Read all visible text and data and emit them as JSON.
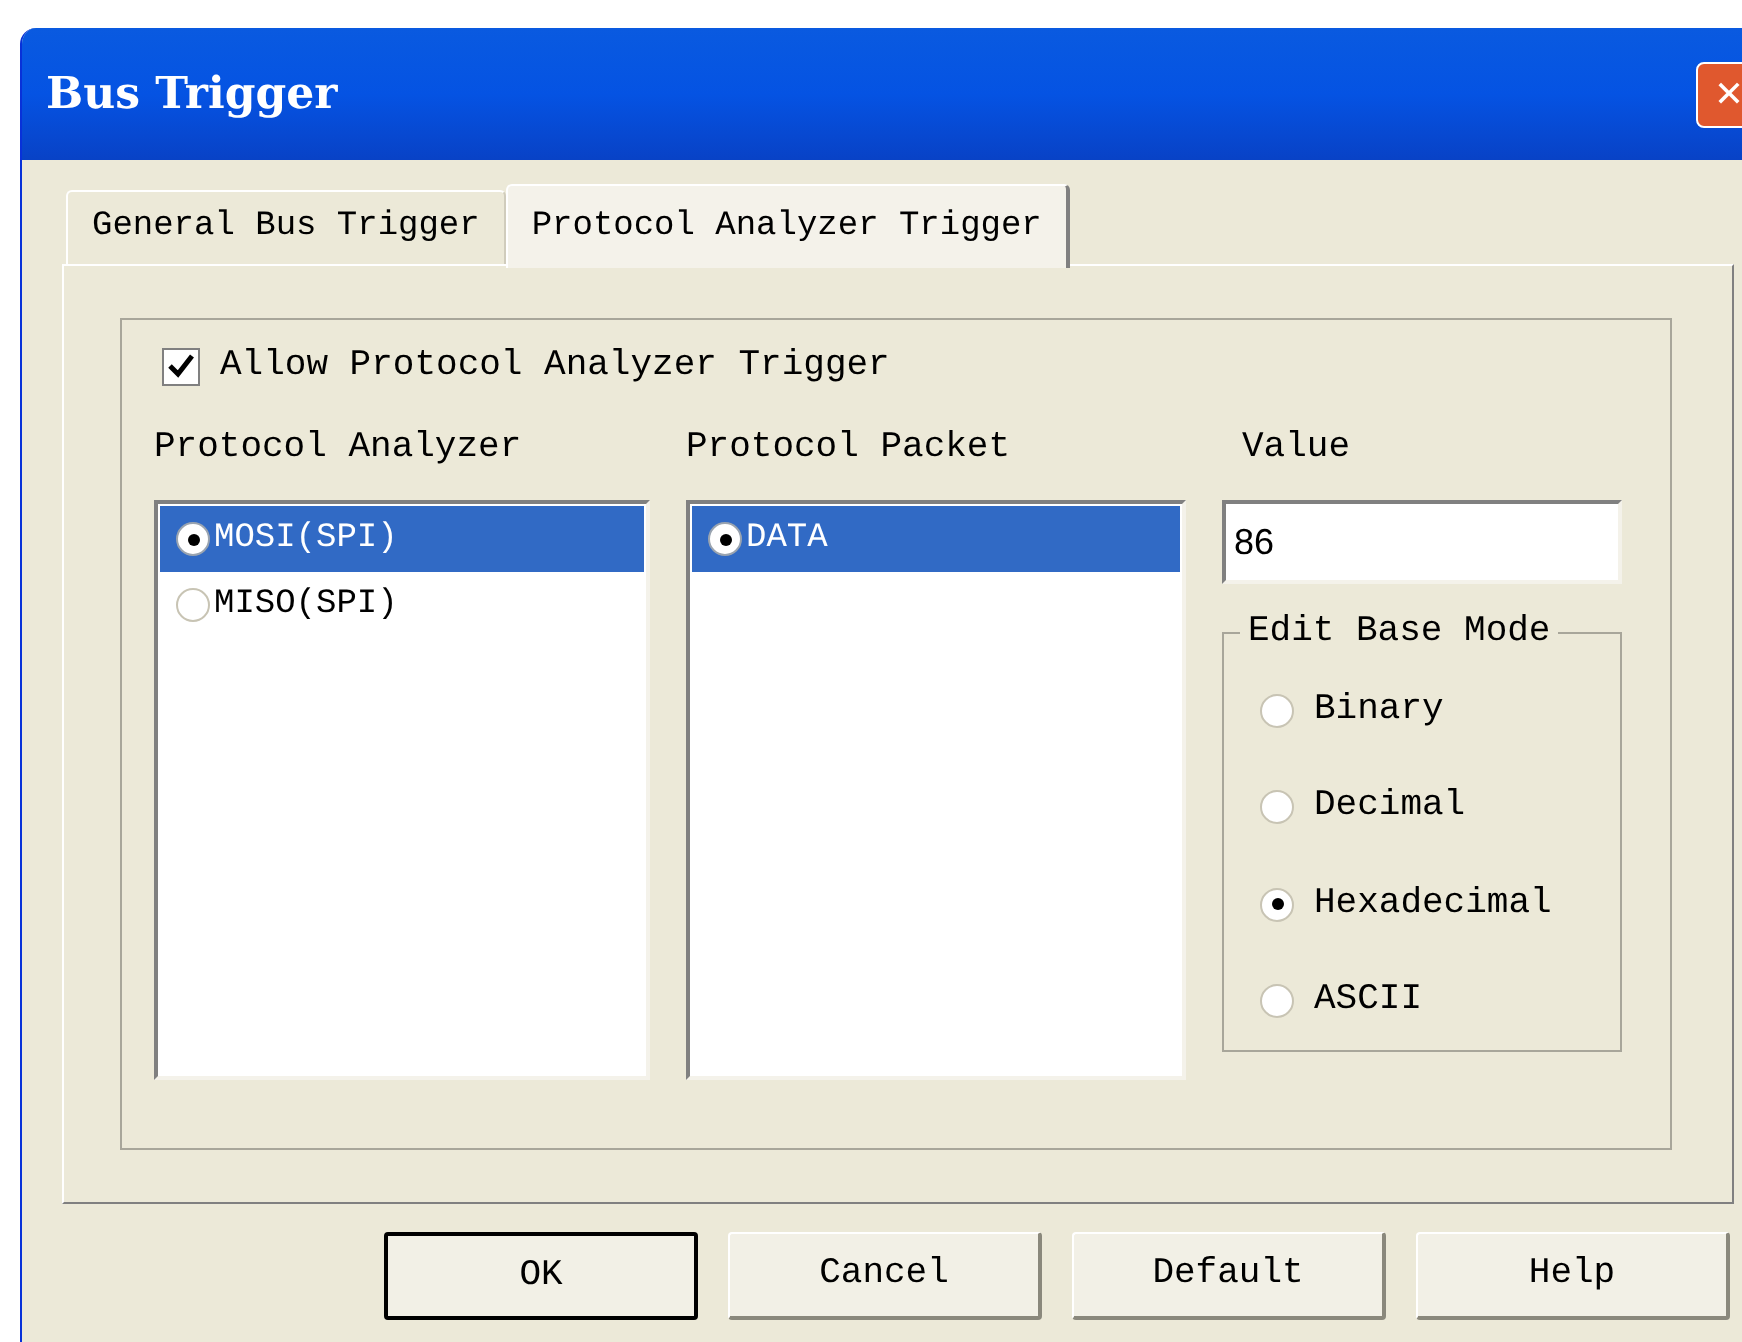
{
  "window": {
    "title": "Bus Trigger",
    "close": "✕"
  },
  "tabs": [
    {
      "label": "General Bus Trigger",
      "selected": false
    },
    {
      "label": "Protocol Analyzer Trigger",
      "selected": true
    }
  ],
  "allow_trigger": {
    "label": "Allow Protocol Analyzer Trigger",
    "checked": true
  },
  "protocol_analyzer": {
    "label": "Protocol Analyzer",
    "items": [
      {
        "label": "MOSI(SPI)",
        "selected": true
      },
      {
        "label": "MISO(SPI)",
        "selected": false
      }
    ]
  },
  "protocol_packet": {
    "label": "Protocol Packet",
    "items": [
      {
        "label": "DATA",
        "selected": true
      }
    ]
  },
  "value": {
    "label": "Value",
    "value": "86"
  },
  "edit_base_mode": {
    "label": "Edit Base Mode",
    "options": [
      {
        "label": "Binary",
        "selected": false
      },
      {
        "label": "Decimal",
        "selected": false
      },
      {
        "label": "Hexadecimal",
        "selected": true
      },
      {
        "label": "ASCII",
        "selected": false
      }
    ]
  },
  "buttons": [
    {
      "label": "OK",
      "default": true
    },
    {
      "label": "Cancel",
      "default": false
    },
    {
      "label": "Default",
      "default": false
    },
    {
      "label": "Help",
      "default": false
    }
  ]
}
